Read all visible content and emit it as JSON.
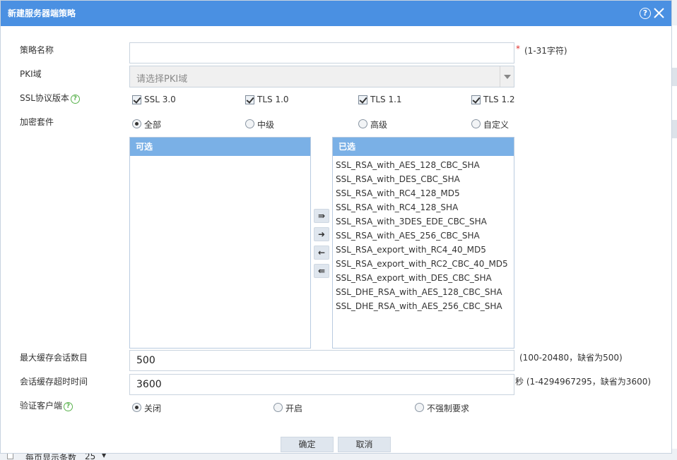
{
  "dialog": {
    "title": "新建服务器端策略",
    "help_glyph": "?",
    "close_glyph": "×"
  },
  "form": {
    "policy_name": {
      "label": "策略名称",
      "value": "",
      "required_mark": "*",
      "hint": "(1-31字符)"
    },
    "pki_domain": {
      "label": "PKI域",
      "placeholder": "请选择PKI域"
    },
    "ssl_version": {
      "label": "SSL协议版本",
      "help_glyph": "?",
      "options": [
        {
          "label": "SSL 3.0",
          "checked": true
        },
        {
          "label": "TLS 1.0",
          "checked": true
        },
        {
          "label": "TLS 1.1",
          "checked": true
        },
        {
          "label": "TLS 1.2",
          "checked": true
        }
      ]
    },
    "cipher_suite": {
      "label": "加密套件",
      "options": [
        {
          "label": "全部",
          "selected": true
        },
        {
          "label": "中级",
          "selected": false
        },
        {
          "label": "高级",
          "selected": false
        },
        {
          "label": "自定义",
          "selected": false
        }
      ],
      "available_header": "可选",
      "selected_header": "已选",
      "available": [],
      "selected": [
        "SSL_RSA_with_AES_128_CBC_SHA",
        "SSL_RSA_with_DES_CBC_SHA",
        "SSL_RSA_with_RC4_128_MD5",
        "SSL_RSA_with_RC4_128_SHA",
        "SSL_RSA_with_3DES_EDE_CBC_SHA",
        "SSL_RSA_with_AES_256_CBC_SHA",
        "SSL_RSA_export_with_RC4_40_MD5",
        "SSL_RSA_export_with_RC2_CBC_40_MD5",
        "SSL_RSA_export_with_DES_CBC_SHA",
        "SSL_DHE_RSA_with_AES_128_CBC_SHA",
        "SSL_DHE_RSA_with_AES_256_CBC_SHA"
      ],
      "move_buttons": {
        "move_all_right": "⇛",
        "move_right": "➜",
        "move_left": "←",
        "move_all_left": "⇚"
      }
    },
    "max_cache": {
      "label": "最大缓存会话数目",
      "value": "500",
      "hint": "(100-20480，缺省为500)"
    },
    "cache_timeout": {
      "label": "会话缓存超时时间",
      "value": "3600",
      "hint": "秒 (1-4294967295，缺省为3600)"
    },
    "verify_client": {
      "label": "验证客户端",
      "help_glyph": "?",
      "options": [
        {
          "label": "关闭",
          "selected": true
        },
        {
          "label": "开启",
          "selected": false
        },
        {
          "label": "不强制要求",
          "selected": false
        }
      ]
    }
  },
  "buttons": {
    "ok": "确定",
    "cancel": "取消"
  },
  "background": {
    "footer_label": "每页显示条数",
    "page_size": "25"
  },
  "colors": {
    "titlebar": "#4a90e2",
    "list_header": "#7ab0e6",
    "required": "#e0312e",
    "help_icon": "#59b24d"
  }
}
